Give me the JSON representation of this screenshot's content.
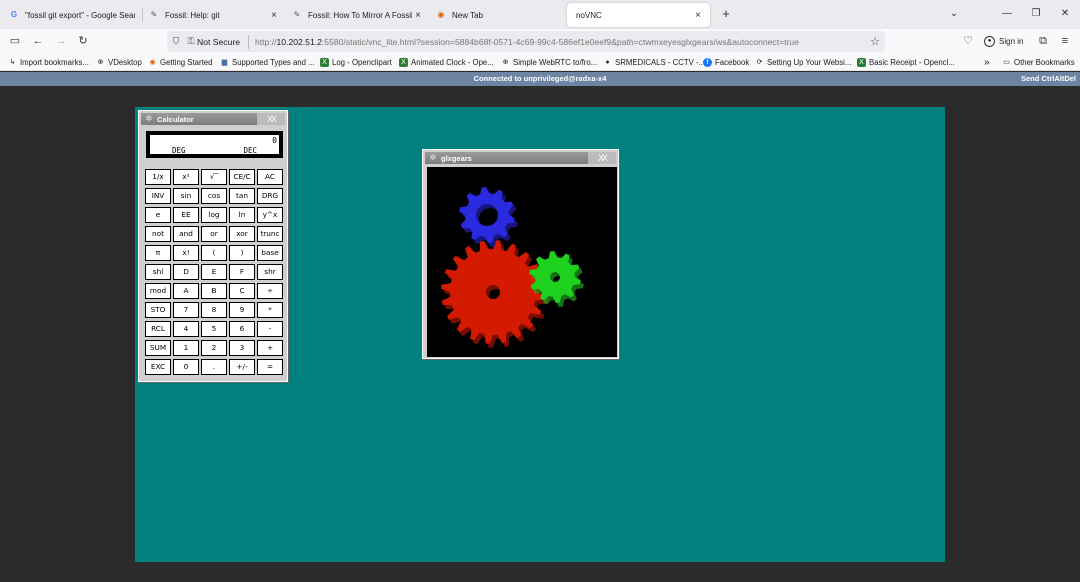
{
  "tabs": [
    {
      "icon": "G",
      "label": "\"fossil git export\" - Google Sear"
    },
    {
      "icon": "✎",
      "label": "Fossil: Help: git"
    },
    {
      "icon": "✎",
      "label": "Fossil: How To Mirror A Fossil R"
    },
    {
      "icon": "◉",
      "label": "New Tab"
    },
    {
      "icon": "",
      "label": "noVNC"
    }
  ],
  "tab_close": "×",
  "new_tab": "+",
  "navbar": {
    "not_secure": "Not Secure",
    "url_prefix": "http://",
    "url_host": "10.202.51.2",
    "url_rest": ":5580/static/vnc_lite.html?session=5884b68f-0571-4c69-99c4-586ef1e0eef9&path=ctwmxeyesglxgears/ws&autoconnect=true",
    "sign_in": "Sign in"
  },
  "bookmarks": [
    {
      "label": "Import bookmarks...",
      "icon": "↳"
    },
    {
      "label": "VDesktop",
      "icon": "⊕"
    },
    {
      "label": "Getting Started",
      "icon": "◉"
    },
    {
      "label": "Supported Types and ...",
      "icon": "▆"
    },
    {
      "label": "Log - Openclipart",
      "icon": "X"
    },
    {
      "label": "Animated Clock - Ope...",
      "icon": "X"
    },
    {
      "label": "Simple WebRTC to/fro...",
      "icon": "⊕"
    },
    {
      "label": "SRMEDICALS - CCTV -...",
      "icon": "●"
    },
    {
      "label": "Facebook",
      "icon": "f"
    },
    {
      "label": "Setting Up Your Websi...",
      "icon": "⟳"
    },
    {
      "label": "Basic Receipt - Opencl...",
      "icon": "X"
    },
    {
      "label": "Other Bookmarks",
      "icon": "▭"
    }
  ],
  "bookmarks_overflow": "»",
  "novnc": {
    "status": "Connected to unprivileged@radxa-x4",
    "ctrl_alt_del": "Send CtrlAltDel"
  },
  "desktop_color": "#008080",
  "calculator": {
    "title": "Calculator",
    "display_value": "0",
    "angle_mode": "DEG",
    "base_mode": "DEC",
    "keys": [
      [
        "1/x",
        "x²",
        "√‾",
        "CE/C",
        "AC"
      ],
      [
        "INV",
        "sin",
        "cos",
        "tan",
        "DRG"
      ],
      [
        "e",
        "EE",
        "log",
        "ln",
        "y^x"
      ],
      [
        "not",
        "and",
        "or",
        "xor",
        "trunc"
      ],
      [
        "π",
        "x!",
        "(",
        ")",
        "base"
      ],
      [
        "shl",
        "D",
        "E",
        "F",
        "shr"
      ],
      [
        "mod",
        "A",
        "B",
        "C",
        "÷"
      ],
      [
        "STO",
        "7",
        "8",
        "9",
        "*"
      ],
      [
        "RCL",
        "4",
        "5",
        "6",
        "-"
      ],
      [
        "SUM",
        "1",
        "2",
        "3",
        "+"
      ],
      [
        "EXC",
        "0",
        ".",
        "+/-",
        "="
      ]
    ]
  },
  "glxgears": {
    "title": "glxgears",
    "gear_colors": [
      "#d41a00",
      "#1fd11f",
      "#2a2ae0"
    ]
  }
}
